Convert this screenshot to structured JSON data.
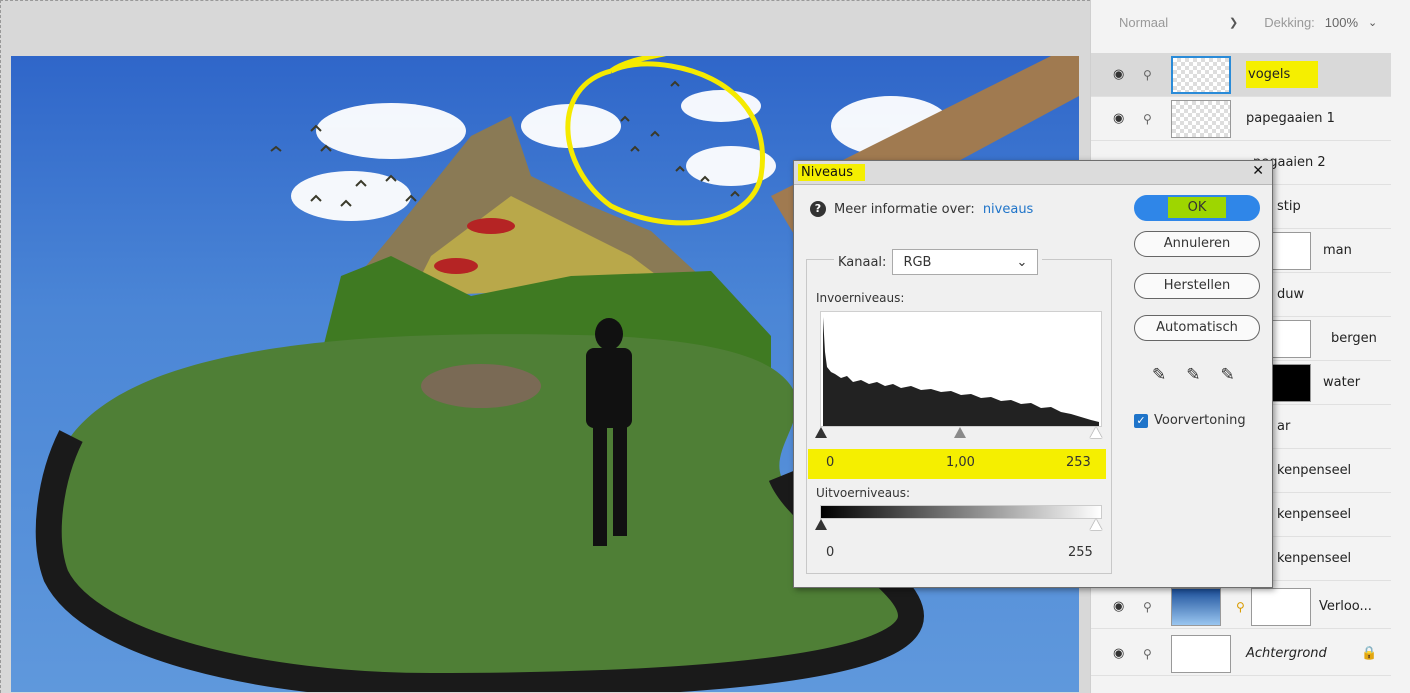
{
  "layers_panel": {
    "blend_mode": "Normaal",
    "opacity_label": "Dekking:",
    "opacity_value": "100%",
    "layers": [
      {
        "name": "vogels",
        "selected": true
      },
      {
        "name": "papegaaien 1"
      },
      {
        "name": "pegaaien 2"
      },
      {
        "name": "stip"
      },
      {
        "name": "man"
      },
      {
        "name": "duw"
      },
      {
        "name": "bergen"
      },
      {
        "name": "water"
      },
      {
        "name": "ar"
      },
      {
        "name": "kenpenseel"
      },
      {
        "name": "kenpenseel"
      },
      {
        "name": "kenpenseel"
      },
      {
        "name": "Verloo..."
      },
      {
        "name": "Achtergrond"
      }
    ]
  },
  "dialog": {
    "title": "Niveaus",
    "info_text": "Meer informatie over:",
    "info_link": "niveaus",
    "channel_label": "Kanaal:",
    "channel_value": "RGB",
    "input_label": "Invoerniveaus:",
    "input_black": "0",
    "input_mid": "1,00",
    "input_white": "253",
    "output_label": "Uitvoerniveaus:",
    "output_black": "0",
    "output_white": "255",
    "ok_label": "OK",
    "cancel_label": "Annuleren",
    "reset_label": "Herstellen",
    "auto_label": "Automatisch",
    "preview_label": "Voorvertoning",
    "preview_checked": true
  },
  "colors": {
    "highlight": "#f5ef00",
    "ok_button": "#2f86e8",
    "annotation": "#f5ea00"
  }
}
